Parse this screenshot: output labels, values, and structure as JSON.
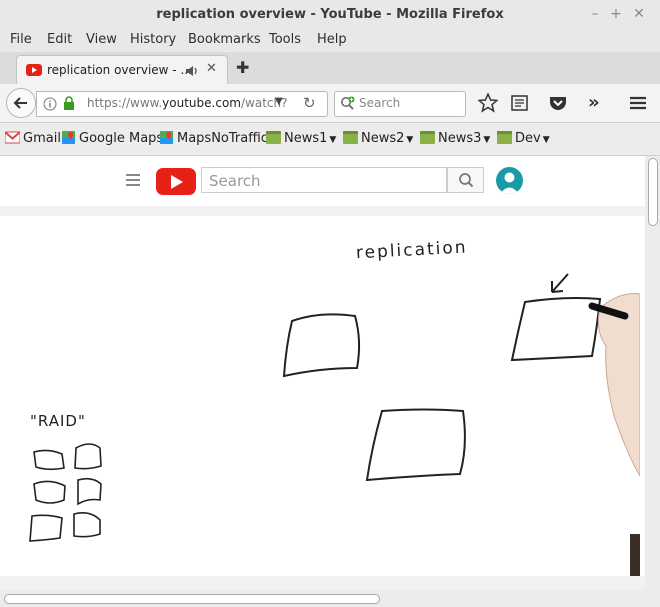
{
  "window": {
    "title": "replication overview - YouTube - Mozilla Firefox"
  },
  "menu": [
    "File",
    "Edit",
    "View",
    "History",
    "Bookmarks",
    "Tools",
    "Help"
  ],
  "tab": {
    "title": "replication overview - ..."
  },
  "nav": {
    "url_prefix": "https://www.",
    "url_host": "youtube.com",
    "url_rest": "/watch?",
    "search_placeholder": "Search"
  },
  "bookmarks": [
    {
      "label": "Gmail",
      "icon": "gmail-icon"
    },
    {
      "label": "Google Maps",
      "icon": "maps-icon"
    },
    {
      "label": "MapsNoTraffic",
      "icon": "maps-icon"
    },
    {
      "label": "News1",
      "icon": "folder-icon"
    },
    {
      "label": "News2",
      "icon": "folder-icon"
    },
    {
      "label": "News3",
      "icon": "folder-icon"
    },
    {
      "label": "Dev",
      "icon": "folder-icon"
    }
  ],
  "youtube": {
    "search_placeholder": "Search"
  },
  "video": {
    "handwritten_title": "replication",
    "handwritten_raid": "\"RAID\""
  },
  "colors": {
    "youtube_red": "#e62117",
    "avatar": "#1a9aa6"
  }
}
